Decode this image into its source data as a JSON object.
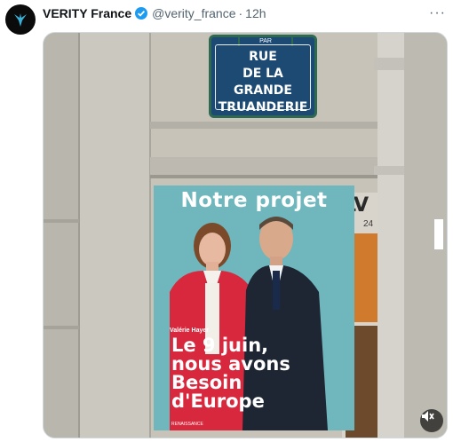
{
  "post": {
    "display_name": "VERITY France",
    "handle": "@verity_france",
    "separator": "·",
    "time": "12h",
    "more": "···"
  },
  "photo": {
    "sign": {
      "top": "PAR",
      "lines": [
        "RUE",
        "DE LA GRANDE",
        "TRUANDERIE"
      ]
    },
    "shop_sign": "LV",
    "shop_number": "24",
    "poster": {
      "title": "Notre projet",
      "candidate": "Valérie Hayer",
      "slogan_lines": [
        "Le 9 juin,",
        "nous avons",
        "Besoin",
        "d'Europe"
      ],
      "footer": "RENAISSANCE"
    }
  },
  "colors": {
    "verified": "#1d9bf0",
    "poster_bg": "#6fb7bd",
    "sign_bg": "#1d4a73",
    "sign_border": "#2d6a51"
  },
  "icons": {
    "avatar": "bird-logo",
    "verified": "verified-badge-icon",
    "more": "more-icon",
    "mute": "mute-icon"
  }
}
